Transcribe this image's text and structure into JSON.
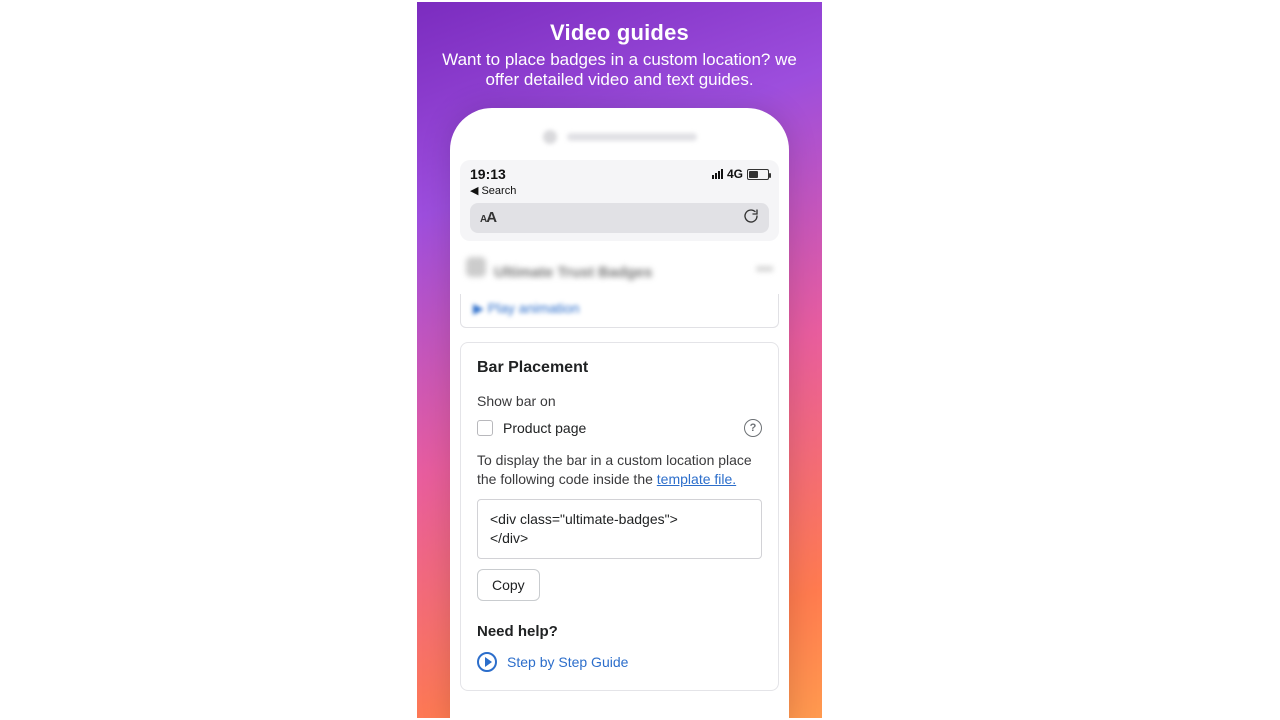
{
  "promo": {
    "title": "Video guides",
    "subtitle": "Want to place badges in a custom location? we offer detailed video and text guides."
  },
  "status": {
    "time": "19:13",
    "back_label": "Search",
    "network": "4G"
  },
  "blurred_app_name": "Ultimate Trust Badges",
  "play_anim": "▶  Play animation",
  "card": {
    "title": "Bar Placement",
    "show_label": "Show bar on",
    "checkbox_label": "Product page",
    "desc_prefix": "To display the bar in a custom location place the following code inside the ",
    "template_link": "template file.",
    "code": "<div class=\"ultimate-badges\">\n</div>",
    "copy_label": "Copy",
    "need_help": "Need help?",
    "guide_label": "Step by Step Guide"
  }
}
